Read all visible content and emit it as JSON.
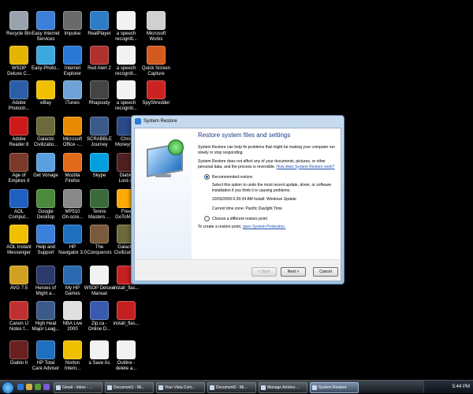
{
  "desktop": {
    "icons": [
      {
        "label": "Recycle Bin",
        "color": "#9aa3ad"
      },
      {
        "label": "Easy Internet\nServices",
        "color": "#3b7fd9"
      },
      {
        "label": "Impulse",
        "color": "#6a6a6a"
      },
      {
        "label": "RealPlayer",
        "color": "#2d7cc6"
      },
      {
        "label": "a speech\nrecogniti...",
        "color": "#f2f2f2"
      },
      {
        "label": "Microsoft\nWorks",
        "color": "#d0d0d0"
      },
      {
        "label": "WSOP\nDeluxe C...",
        "color": "#e5b400"
      },
      {
        "label": "Easy-Photo...",
        "color": "#3ba8e0"
      },
      {
        "label": "Internet\nExplorer",
        "color": "#2a78d6"
      },
      {
        "label": "Red Alert 2",
        "color": "#b03030"
      },
      {
        "label": "a speech\nrecogniti...",
        "color": "#f2f2f2"
      },
      {
        "label": "Quick Screen\nCapture",
        "color": "#d45a1e"
      },
      {
        "label": "Adobe\nPhotosh...",
        "color": "#2a5fa8"
      },
      {
        "label": "eBay",
        "color": "#f0c000"
      },
      {
        "label": "iTunes",
        "color": "#6fa3d8"
      },
      {
        "label": "Rhapsody",
        "color": "#444"
      },
      {
        "label": "a speech\nrecogniti...",
        "color": "#f2f2f2"
      },
      {
        "label": "SpyShredder",
        "color": "#c22"
      },
      {
        "label": "Adobe\nReader 8",
        "color": "#cc1a1a"
      },
      {
        "label": "Galactic\nCivilizatio...",
        "color": "#6c6a3a"
      },
      {
        "label": "Microsoft\nOffice -...",
        "color": "#e88a00"
      },
      {
        "label": "SCRABBLE\nJourney",
        "color": "#3a5a8a"
      },
      {
        "label": "Chris\nMoneym...",
        "color": "#2a4a8a"
      },
      {
        "label": "Age of\nEmpires II",
        "color": "#7a3a2a"
      },
      {
        "label": "Get Vonage",
        "color": "#5aa0e0"
      },
      {
        "label": "Mozilla\nFirefox",
        "color": "#e06a1a"
      },
      {
        "label": "Skype",
        "color": "#00a0e0"
      },
      {
        "label": "Diablo\nLord of",
        "color": "#502020"
      },
      {
        "label": "AOL\nComput...",
        "color": "#1f5fbf"
      },
      {
        "label": "Google\nDesktop",
        "color": "#4a8a3a"
      },
      {
        "label": "MP510\nOn-scre...",
        "color": "#888"
      },
      {
        "label": "Tennis\nMasters ...",
        "color": "#3a6a3a"
      },
      {
        "label": "Free\nGoToMe...",
        "color": "#ffaa00"
      },
      {
        "label": "AOL Instant\nMessenger",
        "color": "#f0c000"
      },
      {
        "label": "Help and\nSupport",
        "color": "#3a7fd9"
      },
      {
        "label": "HP\nNavigator 3.0",
        "color": "#1f6fbf"
      },
      {
        "label": "The\nConquerors",
        "color": "#7a5a3a"
      },
      {
        "label": "Galactic\nCivilizatio...",
        "color": "#6c6a3a"
      },
      {
        "label": "AVG 7.5",
        "color": "#d0a020"
      },
      {
        "label": "Heroes of\nMight a...",
        "color": "#2a3a6a"
      },
      {
        "label": "My HP\nGames",
        "color": "#2a6ab0"
      },
      {
        "label": "WSOP Deluxe\nManual",
        "color": "#f2f2f2"
      },
      {
        "label": "install_flas...",
        "color": "#c42020"
      },
      {
        "label": "Canon IJ\nNotes f...",
        "color": "#c03030"
      },
      {
        "label": "High Heat\nMajor Leag...",
        "color": "#3a5a8a"
      },
      {
        "label": "NBA Live\n2000",
        "color": "#e0e0e0"
      },
      {
        "label": "Zip.ca -\nOnline D...",
        "color": "#3a5ab0"
      },
      {
        "label": "install_flas...",
        "color": "#c42020"
      },
      {
        "label": "Diablo II",
        "color": "#6a2020"
      },
      {
        "label": "HP Total\nCare Advisor",
        "color": "#1f6fbf"
      },
      {
        "label": "Norton\nIntern...",
        "color": "#f0c000"
      },
      {
        "label": "a Save As",
        "color": "#f2f2f2"
      },
      {
        "label": "Outline -\ndelete a...",
        "color": "#f2f2f2"
      }
    ]
  },
  "dialog": {
    "title": "System Restore",
    "heading": "Restore system files and settings",
    "para1": "System Restore can help fix problems that might be making your computer run slowly or stop responding.",
    "para2": "System Restore does not affect any of your documents, pictures, or other personal data, and the process is reversible.",
    "para2_link": "How does System Restore work?",
    "option1_label": "Recommended restore:",
    "option1_desc": "Select this option to undo the most recent update, driver, or software installation if you think it is causing problems.",
    "restore_point": "10/03/2009 6:26:34 AM   Install: Windows Update",
    "timezone": "Current time zone: Pacific Daylight Time",
    "option2_label": "Choose a different restore point",
    "protect_text": "To create a restore point,",
    "protect_link": "open System Protection.",
    "back": "< Back",
    "next": "Next >",
    "cancel": "Cancel"
  },
  "taskbar": {
    "tasks": [
      {
        "label": "Gmail - Inbox - ..."
      },
      {
        "label": "Document1 - Mi..."
      },
      {
        "label": "Your Vista Com..."
      },
      {
        "label": "Document2 - Mi..."
      },
      {
        "label": "Manage Articles ..."
      },
      {
        "label": "System Restore"
      }
    ],
    "clock": "5:44 PM"
  }
}
